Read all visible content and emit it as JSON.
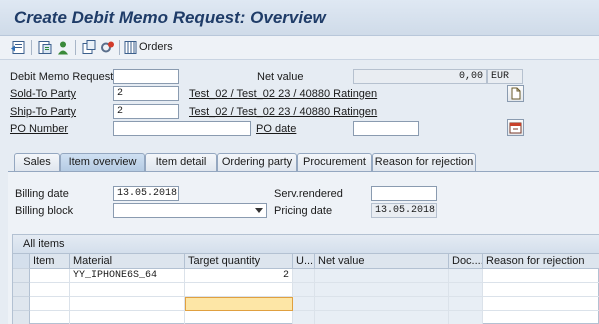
{
  "window": {
    "title": "Create Debit Memo Request: Overview"
  },
  "toolbar": {
    "orders_label": "Orders"
  },
  "header": {
    "debit_memo_label": "Debit Memo Request",
    "debit_memo_value": "",
    "net_value_label": "Net value",
    "net_value": "0,00",
    "currency": "EUR",
    "sold_to_label": "Sold-To Party",
    "sold_to_value": "2",
    "sold_to_desc": "Test_02 / Test_02 23 / 40880 Ratingen",
    "ship_to_label": "Ship-To Party",
    "ship_to_value": "2",
    "ship_to_desc": "Test_02 / Test_02 23 / 40880 Ratingen",
    "po_number_label": "PO Number",
    "po_number_value": "",
    "po_date_label": "PO date",
    "po_date_value": ""
  },
  "tabs": [
    {
      "label": "Sales"
    },
    {
      "label": "Item overview"
    },
    {
      "label": "Item detail"
    },
    {
      "label": "Ordering party"
    },
    {
      "label": "Procurement"
    },
    {
      "label": "Reason for rejection"
    }
  ],
  "item_overview": {
    "billing_date_label": "Billing date",
    "billing_date_value": "13.05.2018",
    "serv_rendered_label": "Serv.rendered",
    "serv_rendered_value": "",
    "billing_block_label": "Billing block",
    "billing_block_value": "",
    "pricing_date_label": "Pricing date",
    "pricing_date_value": "13.05.2018"
  },
  "items_table": {
    "title": "All items",
    "columns": [
      "Item",
      "Material",
      "Target quantity",
      "U...",
      "Net value",
      "Doc....",
      "Reason for rejection"
    ],
    "rows": [
      {
        "item": "",
        "material": "YY_IPHONE6S_64",
        "target_qty": "2",
        "unit": "",
        "net_value": "",
        "doc": "",
        "reason": ""
      }
    ]
  }
}
